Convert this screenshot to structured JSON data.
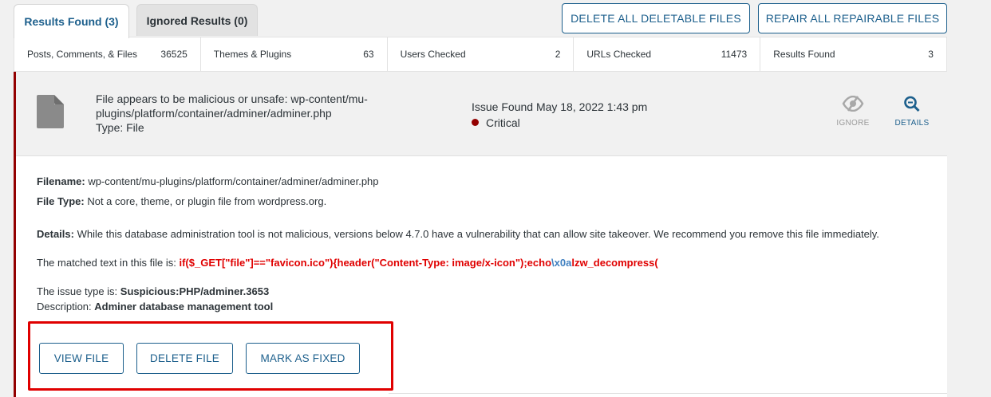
{
  "tabs": {
    "results_found": "Results Found (3)",
    "ignored_results": "Ignored Results (0)"
  },
  "toolbar": {
    "delete_all": "DELETE ALL DELETABLE FILES",
    "repair_all": "REPAIR ALL REPAIRABLE FILES"
  },
  "stats": [
    {
      "label": "Posts, Comments, & Files",
      "value": "36525"
    },
    {
      "label": "Themes & Plugins",
      "value": "63"
    },
    {
      "label": "Users Checked",
      "value": "2"
    },
    {
      "label": "URLs Checked",
      "value": "11473"
    },
    {
      "label": "Results Found",
      "value": "3"
    }
  ],
  "issue": {
    "title": "File appears to be malicious or unsafe: wp-content/mu-plugins/platform/container/adminer/adminer.php",
    "type": "Type: File",
    "found": "Issue Found May 18, 2022 1:43 pm",
    "severity": "Critical",
    "ignore_label": "IGNORE",
    "details_label": "DETAILS",
    "filename_label": "Filename:",
    "filename": "wp-content/mu-plugins/platform/container/adminer/adminer.php",
    "filetype_label": "File Type:",
    "filetype": "Not a core, theme, or plugin file from wordpress.org.",
    "details_label_text": "Details:",
    "details": "While this database administration tool is not malicious, versions below 4.7.0 have a vulnerability that can allow site takeover. We recommend you remove this file immediately.",
    "matched_prefix": "The matched text in this file is:",
    "matched_a": "if($_GET[\"file\"]==\"favicon.ico\"){header(\"Content-Type: image/x-icon\");echo",
    "matched_b": "\\x0a",
    "matched_c": "lzw_decompress(",
    "issue_type_prefix": "The issue type is:",
    "issue_type": "Suspicious:PHP/adminer.3653",
    "description_prefix": "Description:",
    "description": "Adminer database management tool"
  },
  "actions": {
    "view_file": "VIEW FILE",
    "delete_file": "DELETE FILE",
    "mark_fixed": "MARK AS FIXED"
  },
  "colors": {
    "brand_blue": "#1c5f8c",
    "critical": "#930000",
    "highlight_red": "#e00000"
  },
  "icons": [
    "file-icon",
    "eye-slash-icon",
    "search-icon"
  ]
}
